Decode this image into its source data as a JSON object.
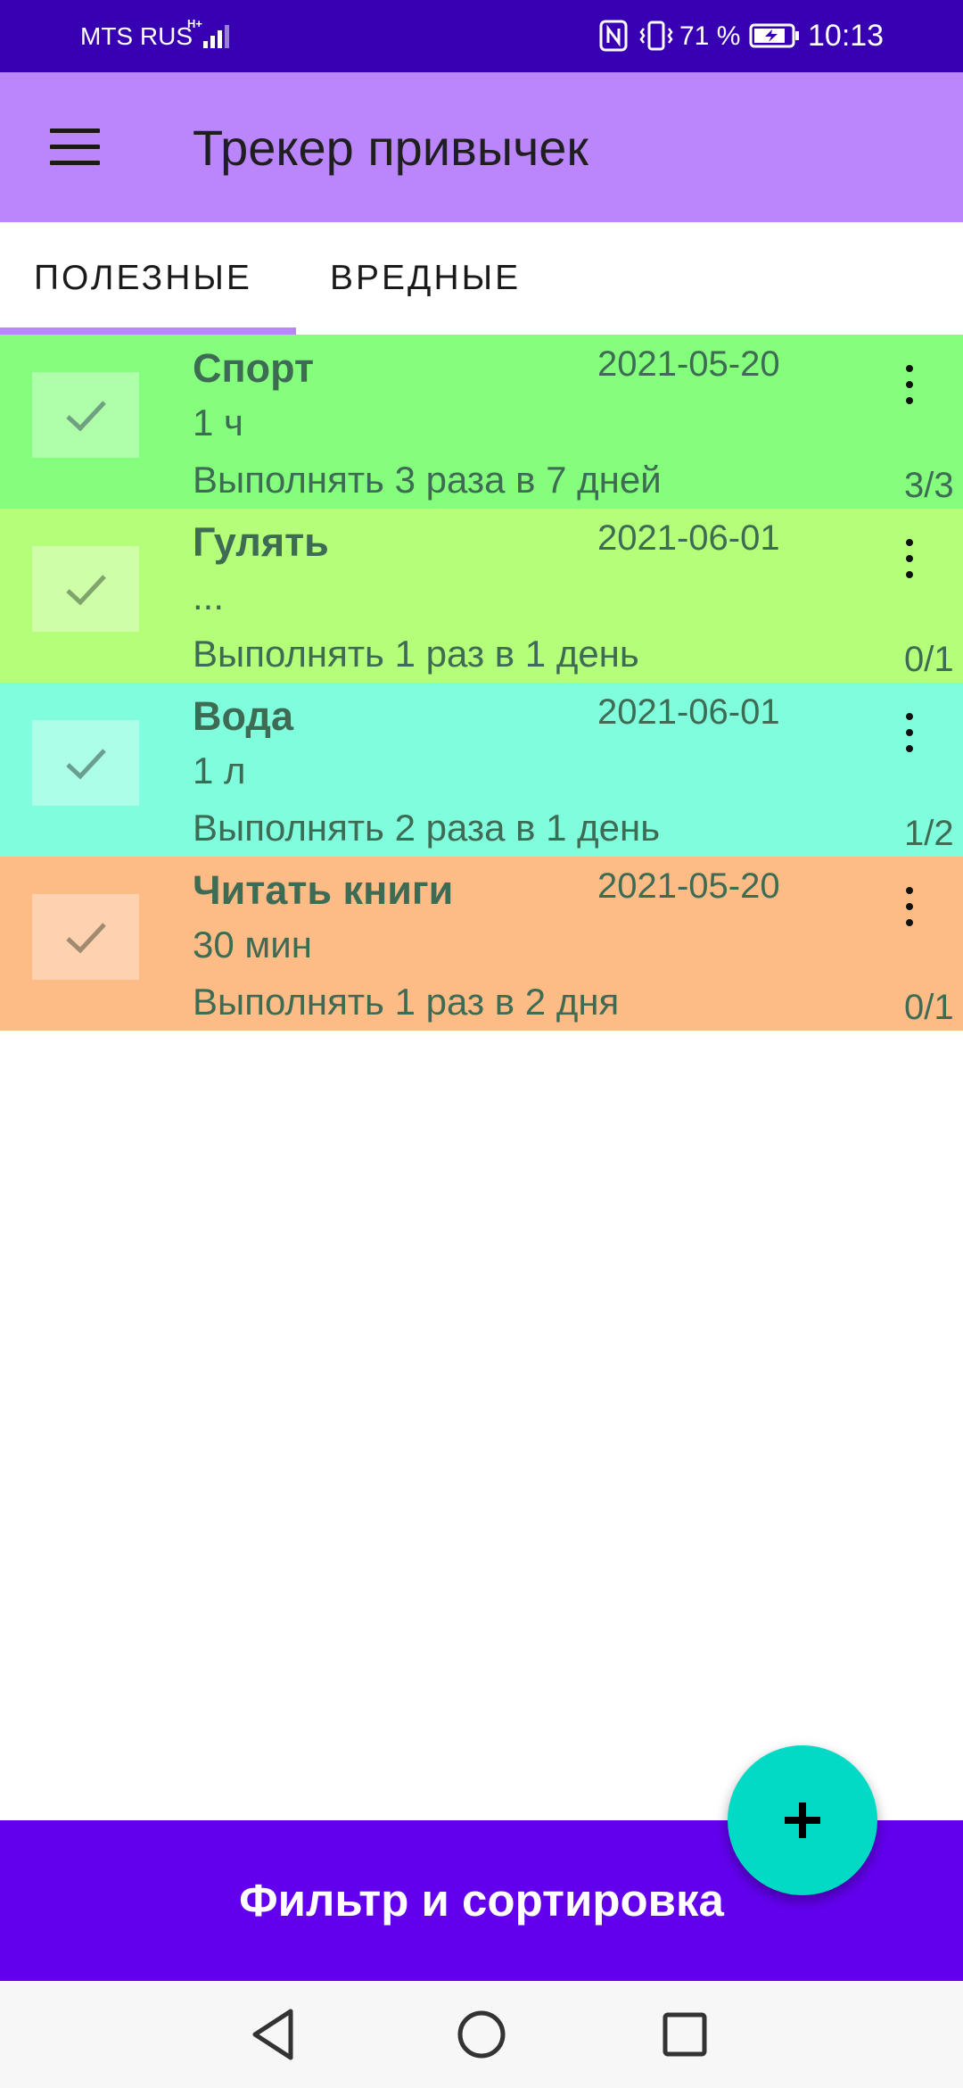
{
  "status_bar": {
    "carrier": "MTS RUS",
    "network_type": "H+",
    "battery_percent": "71 %",
    "time": "10:13",
    "icons": [
      "signal-icon",
      "nfc-icon",
      "vibrate-icon",
      "battery-charging-icon"
    ]
  },
  "app_bar": {
    "title": "Трекер привычек",
    "menu_icon": "hamburger-menu-icon"
  },
  "tabs": [
    {
      "label": "ПОЛЕЗНЫЕ",
      "selected": true
    },
    {
      "label": "ВРЕДНЫЕ",
      "selected": false
    }
  ],
  "habits": [
    {
      "name": "Спорт",
      "date": "2021-05-20",
      "detail": "1 ч",
      "rule": "Выполнять 3 раза в 7 дней",
      "progress": "3/3",
      "color": "#85fd7d"
    },
    {
      "name": "Гулять",
      "date": "2021-06-01",
      "detail": "...",
      "rule": "Выполнять 1 раз в 1 день",
      "progress": "0/1",
      "color": "#b5fe7a"
    },
    {
      "name": "Вода",
      "date": "2021-06-01",
      "detail": "1 л",
      "rule": "Выполнять 2 раза в 1 день",
      "progress": "1/2",
      "color": "#80fddc"
    },
    {
      "name": "Читать книги",
      "date": "2021-05-20",
      "detail": "30 мин",
      "rule": "Выполнять 1 раз в 2 дня",
      "progress": "0/1",
      "color": "#fdbb86"
    }
  ],
  "fab": {
    "icon": "plus-icon",
    "color": "#03dac5"
  },
  "filter_bar": {
    "label": "Фильтр и сортировка",
    "color": "#6200ee"
  },
  "nav_bar": {
    "icons": [
      "back-icon",
      "home-icon",
      "recents-icon"
    ]
  },
  "colors": {
    "status_bar": "#3700b3",
    "app_bar": "#bb86fc",
    "tab_indicator": "#bb86fc"
  }
}
